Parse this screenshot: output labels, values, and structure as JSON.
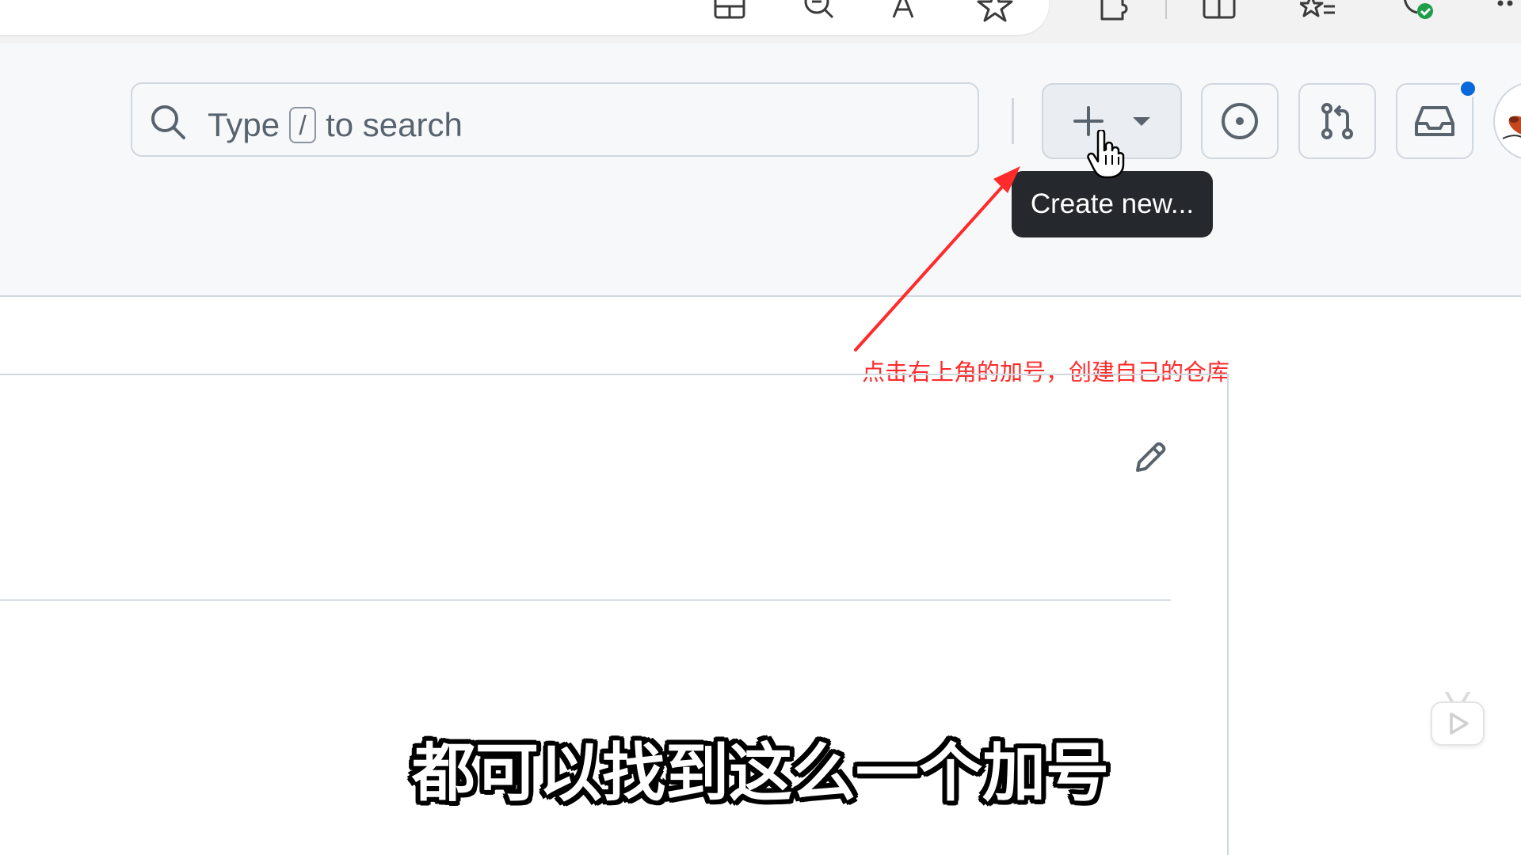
{
  "browser_toolbar": {
    "icons": [
      "grid-icon",
      "zoom-icon",
      "read-aloud-icon",
      "favorite-star-icon",
      "extensions-icon",
      "split-screen-icon",
      "favorites-list-icon",
      "browser-essentials-icon",
      "more-icon"
    ]
  },
  "header": {
    "search": {
      "prefix": "Type",
      "shortcut_key": "/",
      "suffix": "to search"
    },
    "create_button": {
      "icon": "plus-icon",
      "dropdown_icon": "triangle-down-icon"
    },
    "issues_button": {
      "icon": "issue-opened-icon"
    },
    "pull_requests_button": {
      "icon": "git-pull-request-icon"
    },
    "inbox_button": {
      "icon": "inbox-icon",
      "has_notification": true
    },
    "tooltip": "Create new..."
  },
  "annotation": {
    "text": "点击右上角的加号，创建自己的仓库",
    "color": "#ff2a2a"
  },
  "subtitle": "都可以找到这么一个加号",
  "colors": {
    "header_bg": "#f6f8fa",
    "border": "#d0d7de",
    "tooltip_bg": "#25292e",
    "notification_dot": "#0969da"
  }
}
